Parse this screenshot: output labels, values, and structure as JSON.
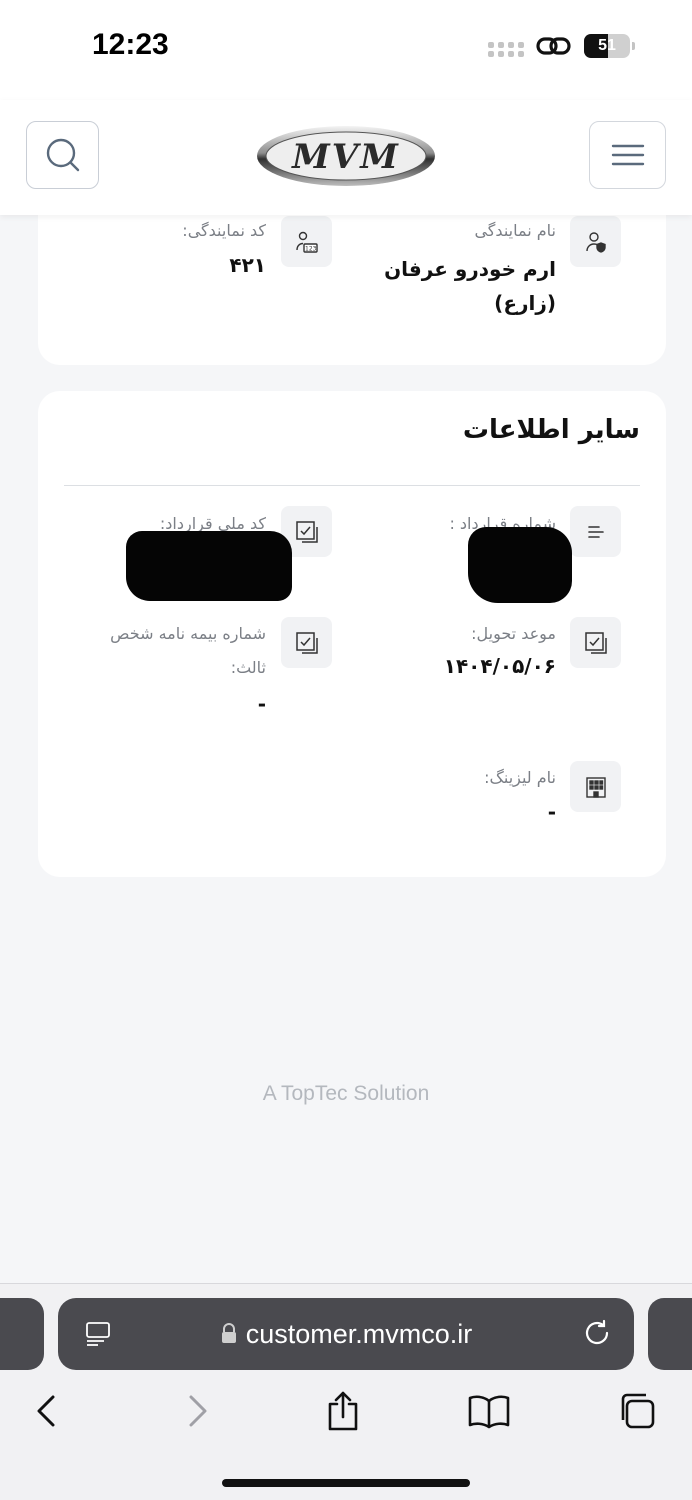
{
  "status_bar": {
    "time": "12:23",
    "battery_level": "51",
    "battery_fraction": 0.51
  },
  "header": {
    "logo_text": "MVM",
    "icons": {
      "search": "search-icon",
      "menu": "hamburger-menu-icon"
    }
  },
  "dealer_card": {
    "dealer_name_label": "نام نمایندگی",
    "dealer_name_value_line1": "ارم خودرو عرفان",
    "dealer_name_value_line2": "(زارع)",
    "dealer_code_label": "کد نمایندگی:",
    "dealer_code_value": "۴۲۱"
  },
  "other_info": {
    "title": "سایر اطلاعات",
    "contract_number_label": "شماره قرارداد :",
    "national_id_label": "کد ملی قرارداد:",
    "delivery_date_label": "موعد تحویل:",
    "delivery_date_value": "۱۴۰۴/۰۵/۰۶",
    "insurance_label": "شماره بیمه نامه شخص ثالث:",
    "insurance_value": "-",
    "leasing_label": "نام لیزینگ:",
    "leasing_value": "-"
  },
  "footer": {
    "brand_text": "A TopTec Solution"
  },
  "browser": {
    "url": "customer.mvmco.ir",
    "icons": [
      "tabs-overview-icon",
      "lock-icon",
      "reload-icon",
      "back-icon",
      "forward-icon",
      "share-icon",
      "bookmarks-icon",
      "tabs-icon"
    ]
  }
}
